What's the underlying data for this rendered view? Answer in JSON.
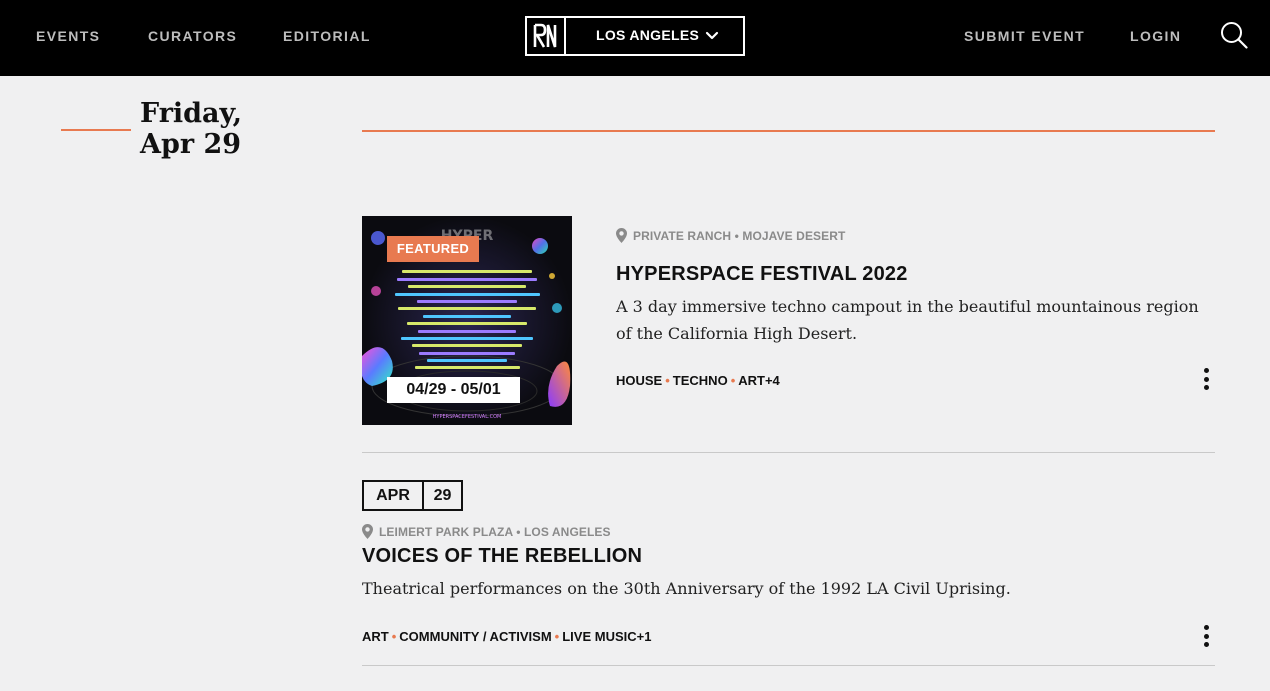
{
  "nav": {
    "events": "EVENTS",
    "curators": "CURATORS",
    "editorial": "EDITORIAL",
    "city": "LOS ANGELES",
    "submit_event": "SUBMIT EVENT",
    "login": "LOGIN"
  },
  "day": {
    "weekday": "Friday,",
    "date": "Apr 29"
  },
  "colors": {
    "accent": "#e87a50",
    "nav_bg": "#000000",
    "page_bg": "#f0f0f1"
  },
  "events": [
    {
      "badge": "FEATURED",
      "poster_dates": "04/29 - 05/01",
      "location": "PRIVATE RANCH • MOJAVE DESERT",
      "title": "HYPERSPACE FESTIVAL 2022",
      "description": "A 3 day immersive techno campout in the beautiful mountainous region of the California High Desert.",
      "tags": [
        "HOUSE",
        "TECHNO",
        "ART+4"
      ]
    },
    {
      "month": "APR",
      "day": "29",
      "location": "LEIMERT PARK PLAZA • LOS ANGELES",
      "title": "VOICES OF THE REBELLION",
      "description": "Theatrical performances on the 30th Anniversary of the 1992 LA Civil Uprising.",
      "tags": [
        "ART",
        "COMMUNITY / ACTIVISM",
        "LIVE MUSIC+1"
      ]
    }
  ],
  "icons": {
    "logo": "ra-logo-icon",
    "dropdown": "chevron-down-icon",
    "search": "search-icon",
    "location": "map-pin-icon",
    "more": "more-vertical-icon"
  }
}
